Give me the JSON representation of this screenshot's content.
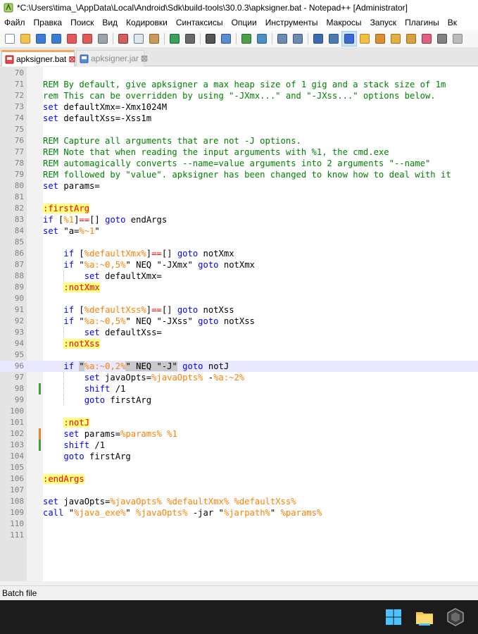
{
  "window": {
    "title": "*C:\\Users\\tima_\\AppData\\Local\\Android\\Sdk\\build-tools\\30.0.3\\apksigner.bat - Notepad++ [Administrator]"
  },
  "menu": [
    {
      "id": "file",
      "label": "Файл"
    },
    {
      "id": "edit",
      "label": "Правка"
    },
    {
      "id": "search",
      "label": "Поиск"
    },
    {
      "id": "view",
      "label": "Вид"
    },
    {
      "id": "encoding",
      "label": "Кодировки"
    },
    {
      "id": "language",
      "label": "Синтаксисы"
    },
    {
      "id": "settings",
      "label": "Опции"
    },
    {
      "id": "tools",
      "label": "Инструменты"
    },
    {
      "id": "macro",
      "label": "Макросы"
    },
    {
      "id": "run",
      "label": "Запуск"
    },
    {
      "id": "plugins",
      "label": "Плагины"
    },
    {
      "id": "window",
      "label": "Вк"
    }
  ],
  "toolbar": [
    {
      "name": "new-file-icon",
      "color": "#ffffff",
      "border": "#6b8fb5"
    },
    {
      "name": "open-file-icon",
      "color": "#f2c14e",
      "border": "#b8892a"
    },
    {
      "name": "save-icon",
      "color": "#3a7bd5",
      "border": "#2a5ca0"
    },
    {
      "name": "save-all-icon",
      "color": "#3a7bd5",
      "border": "#2a5ca0"
    },
    {
      "name": "close-icon",
      "color": "#e05a5a",
      "border": "#a83a3a"
    },
    {
      "name": "close-all-icon",
      "color": "#e05a5a",
      "border": "#a83a3a"
    },
    {
      "name": "print-icon",
      "color": "#9aa4ad",
      "border": "#5f6870"
    },
    {
      "sep": true
    },
    {
      "name": "cut-icon",
      "color": "#d06060",
      "border": "#8a3030"
    },
    {
      "name": "copy-icon",
      "color": "#dfe6ee",
      "border": "#6b7b8c"
    },
    {
      "name": "paste-icon",
      "color": "#c89b5a",
      "border": "#8a6630"
    },
    {
      "sep": true
    },
    {
      "name": "undo-icon",
      "color": "#3aa05a",
      "border": "#206b3a"
    },
    {
      "name": "redo-icon",
      "color": "#6a6a6a",
      "border": "#404040"
    },
    {
      "sep": true
    },
    {
      "name": "find-icon",
      "color": "#555555",
      "border": "#222222"
    },
    {
      "name": "replace-icon",
      "color": "#5a8ad0",
      "border": "#2a5a9a"
    },
    {
      "sep": true
    },
    {
      "name": "zoom-in-icon",
      "color": "#4aa04a",
      "border": "#2a702a"
    },
    {
      "name": "zoom-out-icon",
      "color": "#4a90c0",
      "border": "#2a6090"
    },
    {
      "sep": true
    },
    {
      "name": "sync-vertical-icon",
      "color": "#6a8ab0",
      "border": "#3a5a80"
    },
    {
      "name": "sync-horizontal-icon",
      "color": "#6a8ab0",
      "border": "#3a5a80"
    },
    {
      "sep": true
    },
    {
      "name": "word-wrap-icon",
      "color": "#3a6ab0",
      "border": "#2a4a80"
    },
    {
      "name": "show-all-chars-icon",
      "color": "#4a7ab0",
      "border": "#2a5a90"
    },
    {
      "name": "indent-guide-icon",
      "color": "#3a6ad0",
      "border": "#2a4aa0",
      "active": true
    },
    {
      "name": "user-language-icon",
      "color": "#f0c040",
      "border": "#b08a20"
    },
    {
      "name": "document-map-icon",
      "color": "#d89030",
      "border": "#a06010"
    },
    {
      "name": "function-list-icon",
      "color": "#e0b040",
      "border": "#a07a10"
    },
    {
      "name": "folder-workspace-icon",
      "color": "#d8a040",
      "border": "#a07010"
    },
    {
      "name": "monitoring-icon",
      "color": "#e06080",
      "border": "#a03050"
    },
    {
      "name": "record-macro-icon",
      "color": "#808080",
      "border": "#505050"
    },
    {
      "name": "more-icon",
      "color": "#bbbbbb",
      "border": "#888888"
    }
  ],
  "tabs": [
    {
      "label": "apksigner.bat",
      "close": "⊠"
    },
    {
      "label": "apksigner.jar",
      "close": "⊠"
    }
  ],
  "editor": {
    "lines": [
      {
        "n": "70",
        "segs": []
      },
      {
        "n": "71",
        "segs": [
          {
            "t": "REM By default, give apksigner a max heap size of 1 gig and a stack size of 1m",
            "c": "#008000"
          }
        ]
      },
      {
        "n": "72",
        "segs": [
          {
            "t": "rem This can be overridden by using \"-JXmx...\" and \"-JXss...\" options below.",
            "c": "#008000"
          }
        ]
      },
      {
        "n": "73",
        "segs": [
          {
            "t": "set",
            "c": "#0000ff"
          },
          {
            "t": " defaultXmx=-Xmx1024M"
          }
        ]
      },
      {
        "n": "74",
        "segs": [
          {
            "t": "set",
            "c": "#0000ff"
          },
          {
            "t": " defaultXss=-Xss1m"
          }
        ]
      },
      {
        "n": "75",
        "segs": []
      },
      {
        "n": "76",
        "segs": [
          {
            "t": "REM Capture all arguments that are not -J options.",
            "c": "#008000"
          }
        ]
      },
      {
        "n": "77",
        "segs": [
          {
            "t": "REM Note that when reading the input arguments with %1, the cmd.exe",
            "c": "#008000"
          }
        ]
      },
      {
        "n": "78",
        "segs": [
          {
            "t": "REM automagically converts --name=value arguments into 2 arguments \"--name\"",
            "c": "#008000"
          }
        ]
      },
      {
        "n": "79",
        "segs": [
          {
            "t": "REM followed by \"value\". apksigner has been changed to know how to deal with it",
            "c": "#008000"
          }
        ]
      },
      {
        "n": "80",
        "segs": [
          {
            "t": "set",
            "c": "#0000ff"
          },
          {
            "t": " params="
          }
        ]
      },
      {
        "n": "81",
        "segs": []
      },
      {
        "n": "82",
        "segs": [
          {
            "t": ":firstArg",
            "c": "#ff0000",
            "bg": "#ffff80"
          }
        ]
      },
      {
        "n": "83",
        "segs": [
          {
            "t": "if",
            "c": "#0000ff"
          },
          {
            "t": " ["
          },
          {
            "t": "%1",
            "c": "#ff8000"
          },
          {
            "t": "]"
          },
          {
            "t": "==",
            "c": "#ff0000"
          },
          {
            "t": "[] "
          },
          {
            "t": "goto",
            "c": "#0000ff"
          },
          {
            "t": " endArgs"
          }
        ]
      },
      {
        "n": "84",
        "segs": [
          {
            "t": "set",
            "c": "#0000ff"
          },
          {
            "t": " \"a="
          },
          {
            "t": "%~1",
            "c": "#ff8000"
          },
          {
            "t": "\""
          }
        ]
      },
      {
        "n": "85",
        "segs": []
      },
      {
        "n": "86",
        "segs": [
          {
            "t": "    "
          },
          {
            "t": "if",
            "c": "#0000ff"
          },
          {
            "t": " ["
          },
          {
            "t": "%defaultXmx%",
            "c": "#ff8000"
          },
          {
            "t": "]"
          },
          {
            "t": "==",
            "c": "#ff0000"
          },
          {
            "t": "[] "
          },
          {
            "t": "goto",
            "c": "#0000ff"
          },
          {
            "t": " notXmx"
          }
        ]
      },
      {
        "n": "87",
        "segs": [
          {
            "t": "    "
          },
          {
            "t": "if",
            "c": "#0000ff"
          },
          {
            "t": " \""
          },
          {
            "t": "%a:~0,5%",
            "c": "#ff8000"
          },
          {
            "t": "\" NEQ \"-JXmx\" "
          },
          {
            "t": "goto",
            "c": "#0000ff"
          },
          {
            "t": " notXmx"
          }
        ]
      },
      {
        "n": "88",
        "segs": [
          {
            "t": "        "
          },
          {
            "t": "set",
            "c": "#0000ff"
          },
          {
            "t": " defaultXmx="
          }
        ]
      },
      {
        "n": "89",
        "segs": [
          {
            "t": "    "
          },
          {
            "t": ":notXmx",
            "c": "#ff0000",
            "bg": "#ffff80"
          }
        ]
      },
      {
        "n": "90",
        "segs": []
      },
      {
        "n": "91",
        "segs": [
          {
            "t": "    "
          },
          {
            "t": "if",
            "c": "#0000ff"
          },
          {
            "t": " ["
          },
          {
            "t": "%defaultXss%",
            "c": "#ff8000"
          },
          {
            "t": "]"
          },
          {
            "t": "==",
            "c": "#ff0000"
          },
          {
            "t": "[] "
          },
          {
            "t": "goto",
            "c": "#0000ff"
          },
          {
            "t": " notXss"
          }
        ]
      },
      {
        "n": "92",
        "segs": [
          {
            "t": "    "
          },
          {
            "t": "if",
            "c": "#0000ff"
          },
          {
            "t": " \""
          },
          {
            "t": "%a:~0,5%",
            "c": "#ff8000"
          },
          {
            "t": "\" NEQ \"-JXss\" "
          },
          {
            "t": "goto",
            "c": "#0000ff"
          },
          {
            "t": " notXss"
          }
        ]
      },
      {
        "n": "93",
        "segs": [
          {
            "t": "        "
          },
          {
            "t": "set",
            "c": "#0000ff"
          },
          {
            "t": " defaultXss="
          }
        ]
      },
      {
        "n": "94",
        "segs": [
          {
            "t": "    "
          },
          {
            "t": ":notXss",
            "c": "#ff0000",
            "bg": "#ffff80"
          }
        ]
      },
      {
        "n": "95",
        "segs": []
      },
      {
        "n": "96",
        "current": true,
        "segs": [
          {
            "t": "    "
          },
          {
            "t": "if",
            "c": "#0000ff"
          },
          {
            "t": " "
          },
          {
            "t": "\"",
            "bg": "#c8c8c8"
          },
          {
            "t": "%a:~0,2%",
            "c": "#ff8000"
          },
          {
            "t": "\" NEQ \"-J",
            "bg": "#c8c8c8"
          },
          {
            "t": "\"",
            "bg": "#c8c8c8"
          },
          {
            "t": " "
          },
          {
            "t": "goto",
            "c": "#0000ff"
          },
          {
            "t": " notJ"
          }
        ]
      },
      {
        "n": "97",
        "segs": [
          {
            "t": "        "
          },
          {
            "t": "set",
            "c": "#0000ff"
          },
          {
            "t": " javaOpts="
          },
          {
            "t": "%javaOpts%",
            "c": "#ff8000"
          },
          {
            "t": " -"
          },
          {
            "t": "%a:~2%",
            "c": "#ff8000"
          }
        ]
      },
      {
        "n": "98",
        "change": "#40a040",
        "segs": [
          {
            "t": "        "
          },
          {
            "t": "shift",
            "c": "#0000ff"
          },
          {
            "t": " /1"
          }
        ]
      },
      {
        "n": "99",
        "segs": [
          {
            "t": "        "
          },
          {
            "t": "goto",
            "c": "#0000ff"
          },
          {
            "t": " firstArg"
          }
        ]
      },
      {
        "n": "100",
        "segs": []
      },
      {
        "n": "101",
        "segs": [
          {
            "t": "    "
          },
          {
            "t": ":notJ",
            "c": "#ff0000",
            "bg": "#ffff80"
          }
        ]
      },
      {
        "n": "102",
        "change": "#f08030",
        "segs": [
          {
            "t": "    "
          },
          {
            "t": "set",
            "c": "#0000ff"
          },
          {
            "t": " params="
          },
          {
            "t": "%params%",
            "c": "#ff8000"
          },
          {
            "t": " "
          },
          {
            "t": "%1",
            "c": "#ff8000"
          }
        ]
      },
      {
        "n": "103",
        "change": "#40a040",
        "segs": [
          {
            "t": "    "
          },
          {
            "t": "shift",
            "c": "#0000ff"
          },
          {
            "t": " /1"
          }
        ]
      },
      {
        "n": "104",
        "segs": [
          {
            "t": "    "
          },
          {
            "t": "goto",
            "c": "#0000ff"
          },
          {
            "t": " firstArg"
          }
        ]
      },
      {
        "n": "105",
        "segs": []
      },
      {
        "n": "106",
        "segs": [
          {
            "t": ":endArgs",
            "c": "#ff0000",
            "bg": "#ffff80"
          }
        ]
      },
      {
        "n": "107",
        "segs": []
      },
      {
        "n": "108",
        "segs": [
          {
            "t": "set",
            "c": "#0000ff"
          },
          {
            "t": " javaOpts="
          },
          {
            "t": "%javaOpts%",
            "c": "#ff8000"
          },
          {
            "t": " "
          },
          {
            "t": "%defaultXmx%",
            "c": "#ff8000"
          },
          {
            "t": " "
          },
          {
            "t": "%defaultXss%",
            "c": "#ff8000"
          }
        ]
      },
      {
        "n": "109",
        "segs": [
          {
            "t": "call",
            "c": "#0000ff"
          },
          {
            "t": " \""
          },
          {
            "t": "%java_exe%",
            "c": "#ff8000"
          },
          {
            "t": "\" "
          },
          {
            "t": "%javaOpts%",
            "c": "#ff8000"
          },
          {
            "t": " -jar \""
          },
          {
            "t": "%jarpath%",
            "c": "#ff8000"
          },
          {
            "t": "\" "
          },
          {
            "t": "%params%",
            "c": "#ff8000"
          }
        ]
      },
      {
        "n": "110",
        "segs": []
      },
      {
        "n": "111",
        "segs": []
      }
    ]
  },
  "status": {
    "text": "Batch file"
  },
  "taskbar": [
    {
      "name": "start-icon"
    },
    {
      "name": "file-explorer-icon"
    },
    {
      "name": "app-icon"
    }
  ]
}
